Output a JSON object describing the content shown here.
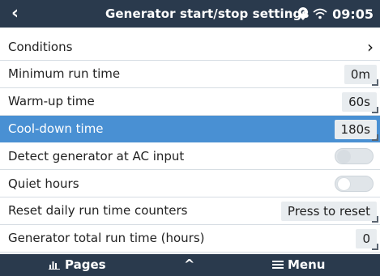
{
  "header": {
    "back_icon": "back-chevron-icon",
    "title": "Generator start/stop settings",
    "time": "09:05"
  },
  "rows": [
    {
      "label": "Conditions",
      "control": "chevron"
    },
    {
      "label": "Minimum run time",
      "value": "0m"
    },
    {
      "label": "Warm-up time",
      "value": "60s"
    },
    {
      "label": "Cool-down time",
      "value": "180s",
      "selected": true
    },
    {
      "label": "Detect generator at AC input",
      "control": "switch",
      "state": "off"
    },
    {
      "label": "Quiet hours",
      "control": "switch",
      "state": "off"
    },
    {
      "label": "Reset daily run time counters",
      "value": "Press to reset"
    },
    {
      "label": "Generator total run time (hours)",
      "value": "0"
    }
  ],
  "footer": {
    "pages_label": "Pages",
    "up_symbol": "^",
    "menu_label": "Menu"
  },
  "colors": {
    "header_bg": "#2a3a4d",
    "selected_bg": "#4990d3"
  }
}
